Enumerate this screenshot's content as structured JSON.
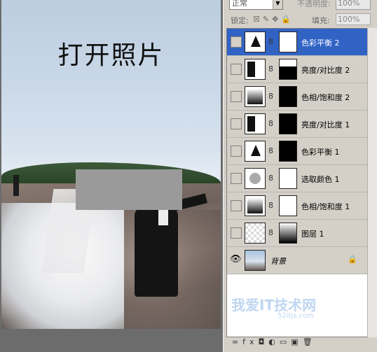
{
  "canvas": {
    "title": "打开照片"
  },
  "panel": {
    "blend_mode": "正常",
    "opacity_label": "不透明度:",
    "opacity_value": "100%",
    "lock_label": "锁定:",
    "fill_label": "填充:",
    "fill_value": "100%"
  },
  "layers": [
    {
      "name": "色彩平衡 2",
      "selected": true,
      "thumb": "color-balance",
      "mask": "white"
    },
    {
      "name": "亮度/对比度 2",
      "selected": false,
      "thumb": "brightness-contrast",
      "mask": "half"
    },
    {
      "name": "色相/饱和度 2",
      "selected": false,
      "thumb": "hue-saturation",
      "mask": "dark"
    },
    {
      "name": "亮度/对比度 1",
      "selected": false,
      "thumb": "brightness-contrast",
      "mask": "dark"
    },
    {
      "name": "色彩平衡 1",
      "selected": false,
      "thumb": "color-balance",
      "mask": "dark"
    },
    {
      "name": "选取颜色 1",
      "selected": false,
      "thumb": "selective-color",
      "mask": "white"
    },
    {
      "name": "色相/饱和度 1",
      "selected": false,
      "thumb": "hue-saturation",
      "mask": "white"
    },
    {
      "name": "图层 1",
      "selected": false,
      "thumb": "layer-image",
      "mask": "gradient"
    },
    {
      "name": "背景",
      "selected": false,
      "thumb": "background-photo",
      "mask": "none",
      "visible": true,
      "locked": true
    }
  ],
  "watermark": {
    "text": "我爱IT技术网",
    "sub": "52itjs.com"
  },
  "icons": {
    "eye": "eye-icon",
    "chain": "link-icon",
    "lock": "lock-icon"
  }
}
